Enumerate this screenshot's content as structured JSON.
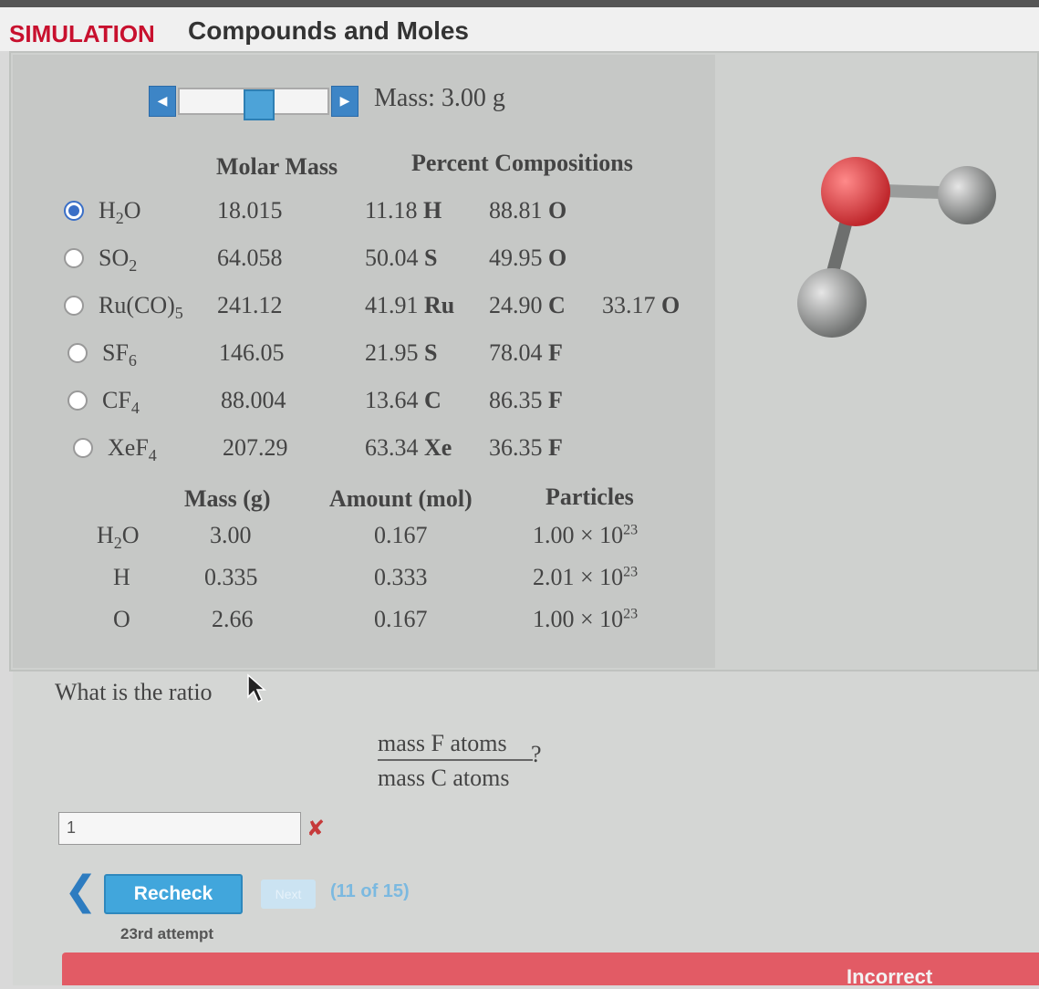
{
  "header": {
    "sim": "SIMULATION",
    "title": "Compounds and Moles"
  },
  "slider": {
    "prev_icon": "◀",
    "next_icon": "▶",
    "mass_label": "Mass: 3.00 g"
  },
  "compounds_table": {
    "headers": {
      "molar_mass": "Molar Mass",
      "percent": "Percent Compositions"
    },
    "rows": [
      {
        "selected": true,
        "name_base": "H",
        "name_sub": "2",
        "name_tail": "O",
        "molar_mass": "18.015",
        "p1": "11.18",
        "e1": "H",
        "p2": "88.81",
        "e2": "O",
        "p3": "",
        "e3": ""
      },
      {
        "selected": false,
        "name_base": "SO",
        "name_sub": "2",
        "name_tail": "",
        "molar_mass": "64.058",
        "p1": "50.04",
        "e1": "S",
        "p2": "49.95",
        "e2": "O",
        "p3": "",
        "e3": ""
      },
      {
        "selected": false,
        "name_base": "Ru(CO)",
        "name_sub": "5",
        "name_tail": "",
        "molar_mass": "241.12",
        "p1": "41.91",
        "e1": "Ru",
        "p2": "24.90",
        "e2": "C",
        "p3": "33.17",
        "e3": "O"
      },
      {
        "selected": false,
        "name_base": "SF",
        "name_sub": "6",
        "name_tail": "",
        "molar_mass": "146.05",
        "p1": "21.95",
        "e1": "S",
        "p2": "78.04",
        "e2": "F",
        "p3": "",
        "e3": ""
      },
      {
        "selected": false,
        "name_base": "CF",
        "name_sub": "4",
        "name_tail": "",
        "molar_mass": "88.004",
        "p1": "13.64",
        "e1": "C",
        "p2": "86.35",
        "e2": "F",
        "p3": "",
        "e3": ""
      },
      {
        "selected": false,
        "name_base": "XeF",
        "name_sub": "4",
        "name_tail": "",
        "molar_mass": "207.29",
        "p1": "63.34",
        "e1": "Xe",
        "p2": "36.35",
        "e2": "F",
        "p3": "",
        "e3": ""
      }
    ]
  },
  "amounts_table": {
    "headers": {
      "mass": "Mass (g)",
      "amount": "Amount (mol)",
      "particles": "Particles"
    },
    "rows": [
      {
        "label_base": "H",
        "label_sub": "2",
        "label_tail": "O",
        "mass": "3.00",
        "amount": "0.167",
        "particles": "1.00 × 10",
        "exp": "23"
      },
      {
        "label_base": "H",
        "label_sub": "",
        "label_tail": "",
        "mass": "0.335",
        "amount": "0.333",
        "particles": "2.01 × 10",
        "exp": "23"
      },
      {
        "label_base": "O",
        "label_sub": "",
        "label_tail": "",
        "mass": "2.66",
        "amount": "0.167",
        "particles": "1.00 × 10",
        "exp": "23"
      }
    ]
  },
  "colors": {
    "oxygen": "#c0282d",
    "hydrogen": "#6f7170",
    "accent": "#41a6dc",
    "error": "#e25b65"
  },
  "question": {
    "text": "What is the ratio",
    "numerator": "mass F atoms",
    "denominator": "mass C atoms",
    "suffix": "?",
    "answer_value": "1",
    "error_icon": "✘"
  },
  "nav": {
    "back_icon": "❮",
    "recheck_label": "Recheck",
    "next_label": "Next",
    "progress": "(11 of 15)",
    "attempt": "23rd attempt"
  },
  "feedback": {
    "status": "Incorrect"
  }
}
